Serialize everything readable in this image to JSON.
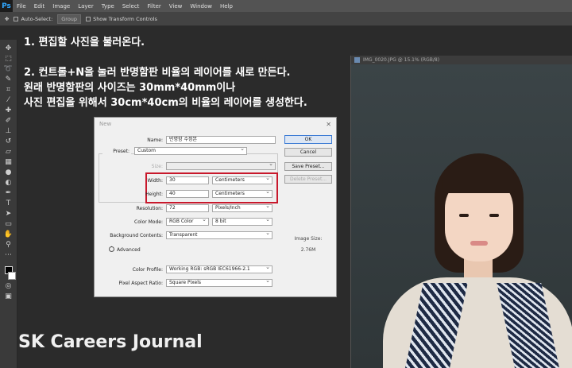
{
  "menubar": {
    "logo": "Ps",
    "items": [
      "File",
      "Edit",
      "Image",
      "Layer",
      "Type",
      "Select",
      "Filter",
      "View",
      "Window",
      "Help"
    ]
  },
  "optbar": {
    "auto_select_label": "Auto-Select:",
    "group_value": "Group",
    "show_transform_label": "Show Transform Controls"
  },
  "instructions": {
    "step1": "1. 편집할 사진을 불러온다.",
    "step2_line1": "2. 컨트롤+N을 눌러 반명함판 비율의 레이어를 새로 만든다.",
    "step2_line2": "원래 반명함판의 사이즈는 30mm*40mm이나",
    "step2_line3": "사진 편집을 위해서 30cm*40cm의 비율의 레이어를 생성한다."
  },
  "document": {
    "tab_title": "IMG_0020.JPG @ 15.1% (RGB/8)"
  },
  "dialog": {
    "title": "New",
    "close": "✕",
    "name_label": "Name:",
    "name_value": "반명함 수정본",
    "preset_label": "Preset:",
    "preset_value": "Custom",
    "size_label": "Size:",
    "width_label": "Width:",
    "width_value": "30",
    "width_unit": "Centimeters",
    "height_label": "Height:",
    "height_value": "40",
    "height_unit": "Centimeters",
    "resolution_label": "Resolution:",
    "resolution_value": "72",
    "resolution_unit": "Pixels/Inch",
    "color_mode_label": "Color Mode:",
    "color_mode_value": "RGB Color",
    "bit_depth": "8 bit",
    "bg_contents_label": "Background Contents:",
    "bg_contents_value": "Transparent",
    "advanced_label": "Advanced",
    "color_profile_label": "Color Profile:",
    "color_profile_value": "Working RGB:  sRGB IEC61966-2.1",
    "pixel_aspect_label": "Pixel Aspect Ratio:",
    "pixel_aspect_value": "Square Pixels",
    "image_size_label": "Image Size:",
    "image_size_value": "2.76M",
    "ok_button": "OK",
    "cancel_button": "Cancel",
    "save_preset_button": "Save Preset...",
    "delete_preset_button": "Delete Preset..."
  },
  "watermark": "SK Careers Journal",
  "colors": {
    "highlight_box": "#c8192c",
    "menubar_bg": "#535353",
    "workspace_bg": "#2b2b2b"
  }
}
